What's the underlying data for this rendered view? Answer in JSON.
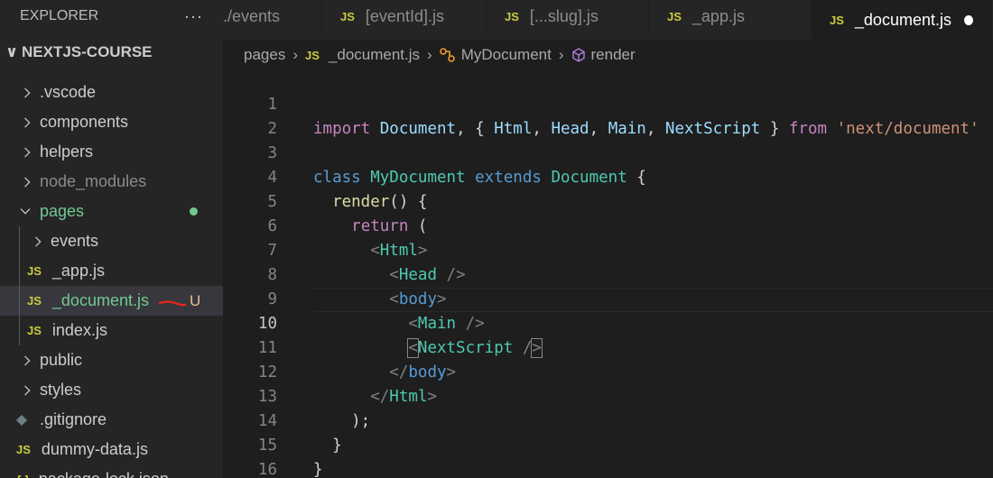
{
  "sidebar": {
    "title": "EXPLORER",
    "more": "···",
    "project": "NEXTJS-COURSE",
    "items": [
      {
        "label": ".vscode",
        "kind": "folder"
      },
      {
        "label": "components",
        "kind": "folder"
      },
      {
        "label": "helpers",
        "kind": "folder"
      },
      {
        "label": "node_modules",
        "kind": "folder"
      },
      {
        "label": "pages",
        "kind": "folder-open"
      },
      {
        "label": "events",
        "kind": "folder"
      },
      {
        "label": "_app.js",
        "kind": "js"
      },
      {
        "label": "_document.js",
        "kind": "js",
        "badge": "U"
      },
      {
        "label": "index.js",
        "kind": "js"
      },
      {
        "label": "public",
        "kind": "folder"
      },
      {
        "label": "styles",
        "kind": "folder"
      },
      {
        "label": ".gitignore",
        "kind": "file"
      },
      {
        "label": "dummy-data.js",
        "kind": "js"
      },
      {
        "label": "package-lock.json",
        "kind": "json"
      }
    ],
    "js_badge": "JS",
    "json_badge": "{ }"
  },
  "tabs": [
    {
      "label": ".../events",
      "js": false
    },
    {
      "label": "[eventId].js",
      "js": true
    },
    {
      "label": "[...slug].js",
      "js": true
    },
    {
      "label": "_app.js",
      "js": true
    },
    {
      "label": "_document.js",
      "js": true,
      "active": true
    }
  ],
  "breadcrumb": {
    "folder": "pages",
    "file": "_document.js",
    "class": "MyDocument",
    "method": "render"
  },
  "editor": {
    "current_line": 10,
    "line_numbers": [
      "1",
      "2",
      "3",
      "4",
      "5",
      "6",
      "7",
      "8",
      "9",
      "10",
      "11",
      "12",
      "13",
      "14",
      "15",
      "16"
    ]
  },
  "colors": {
    "keyword": "#c586c0",
    "class": "#4ec9b0",
    "string": "#ce9178",
    "variable": "#9cdcfe",
    "accent_js": "#cbcb41",
    "git_untracked": "#73c991"
  }
}
